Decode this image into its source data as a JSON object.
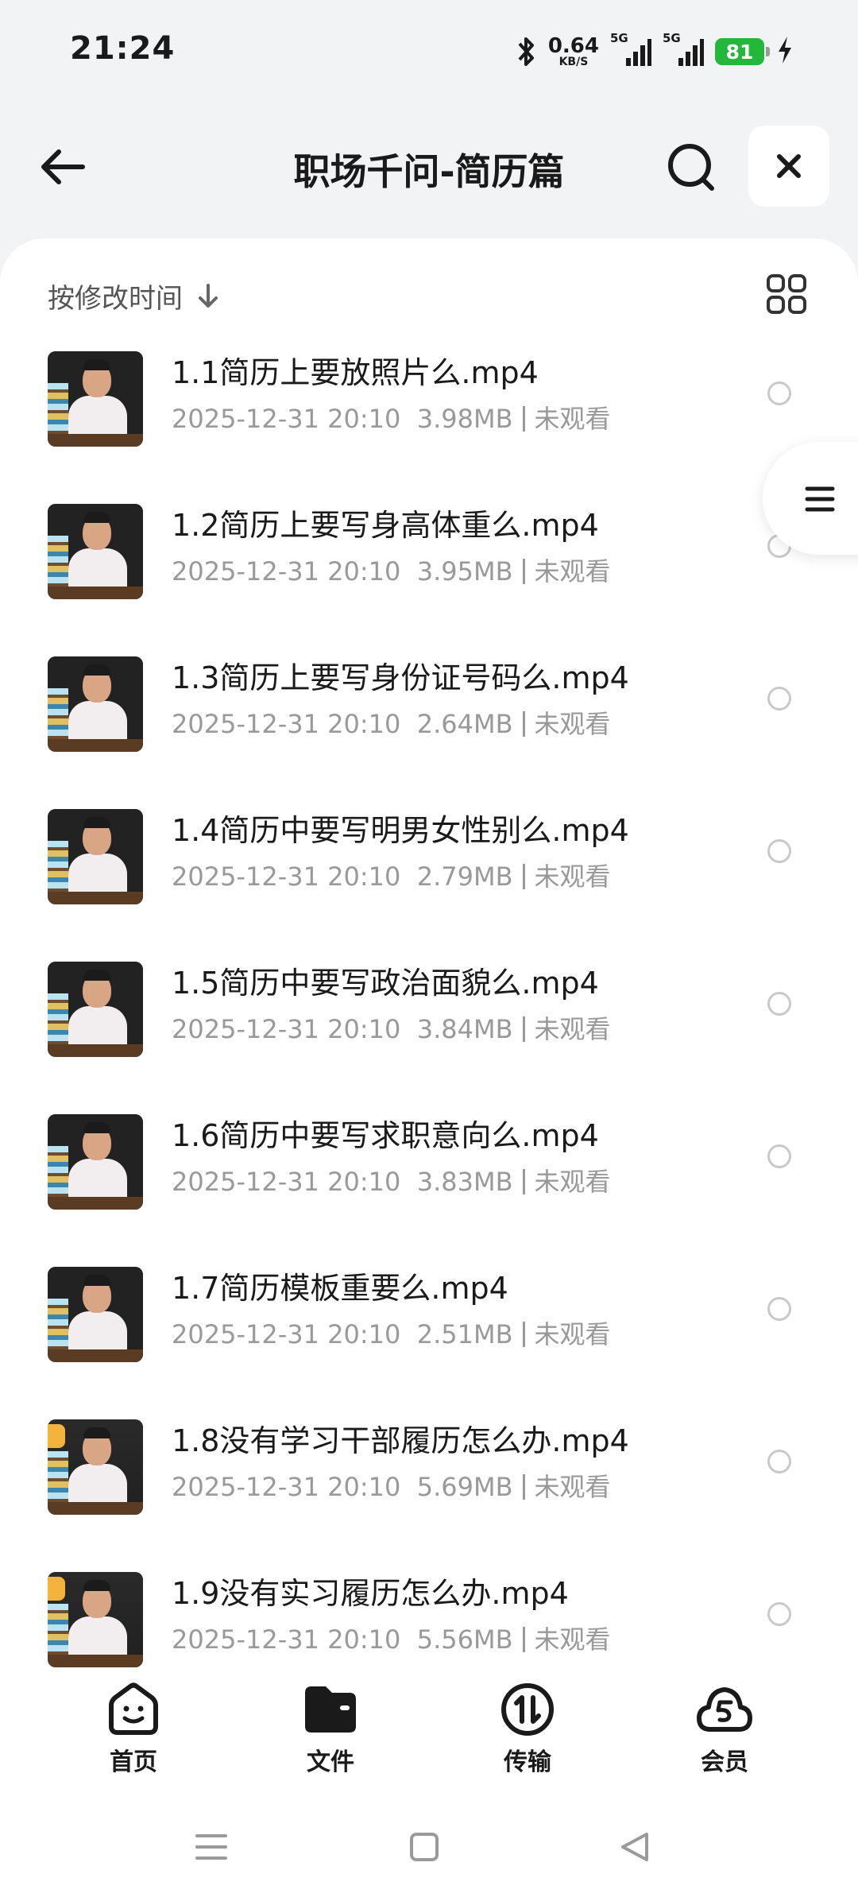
{
  "status_bar": {
    "time": "21:24",
    "net_speed": "0.64",
    "net_unit": "KB/S",
    "signal_1": "5G",
    "signal_2": "5G",
    "battery": "81",
    "icons": [
      "bluetooth-icon",
      "signal-icon",
      "battery-icon",
      "charging-icon"
    ]
  },
  "header": {
    "title": "职场千问-简历篇",
    "back_icon": "arrow-left-icon",
    "search_icon": "search-icon",
    "close_icon": "close-icon"
  },
  "sort": {
    "label": "按修改时间",
    "direction_icon": "arrow-down-icon",
    "view_toggle_icon": "grid-view-icon"
  },
  "files": [
    {
      "name": "1.1简历上要放照片么.mp4",
      "date": "2025-12-31 20:10",
      "size": "3.98MB",
      "status": "未观看"
    },
    {
      "name": "1.2简历上要写身高体重么.mp4",
      "date": "2025-12-31 20:10",
      "size": "3.95MB",
      "status": "未观看"
    },
    {
      "name": "1.3简历上要写身份证号码么.mp4",
      "date": "2025-12-31 20:10",
      "size": "2.64MB",
      "status": "未观看"
    },
    {
      "name": "1.4简历中要写明男女性别么.mp4",
      "date": "2025-12-31 20:10",
      "size": "2.79MB",
      "status": "未观看"
    },
    {
      "name": "1.5简历中要写政治面貌么.mp4",
      "date": "2025-12-31 20:10",
      "size": "3.84MB",
      "status": "未观看"
    },
    {
      "name": "1.6简历中要写求职意向么.mp4",
      "date": "2025-12-31 20:10",
      "size": "3.83MB",
      "status": "未观看"
    },
    {
      "name": "1.7简历模板重要么.mp4",
      "date": "2025-12-31 20:10",
      "size": "2.51MB",
      "status": "未观看"
    },
    {
      "name": "1.8没有学习干部履历怎么办.mp4",
      "date": "2025-12-31 20:10",
      "size": "5.69MB",
      "status": "未观看"
    },
    {
      "name": "1.9没有实习履历怎么办.mp4",
      "date": "2025-12-31 20:10",
      "size": "5.56MB",
      "status": "未观看"
    }
  ],
  "bottom_nav": {
    "items": [
      {
        "label": "首页",
        "icon": "home-face-icon"
      },
      {
        "label": "文件",
        "icon": "folder-icon"
      },
      {
        "label": "传输",
        "icon": "transfer-icon"
      },
      {
        "label": "会员",
        "icon": "vip-cloud-icon"
      }
    ],
    "active_index": 1
  },
  "floating_menu_icon": "menu-lines-icon",
  "system_nav": [
    "menu-icon",
    "home-square-icon",
    "back-triangle-icon"
  ]
}
